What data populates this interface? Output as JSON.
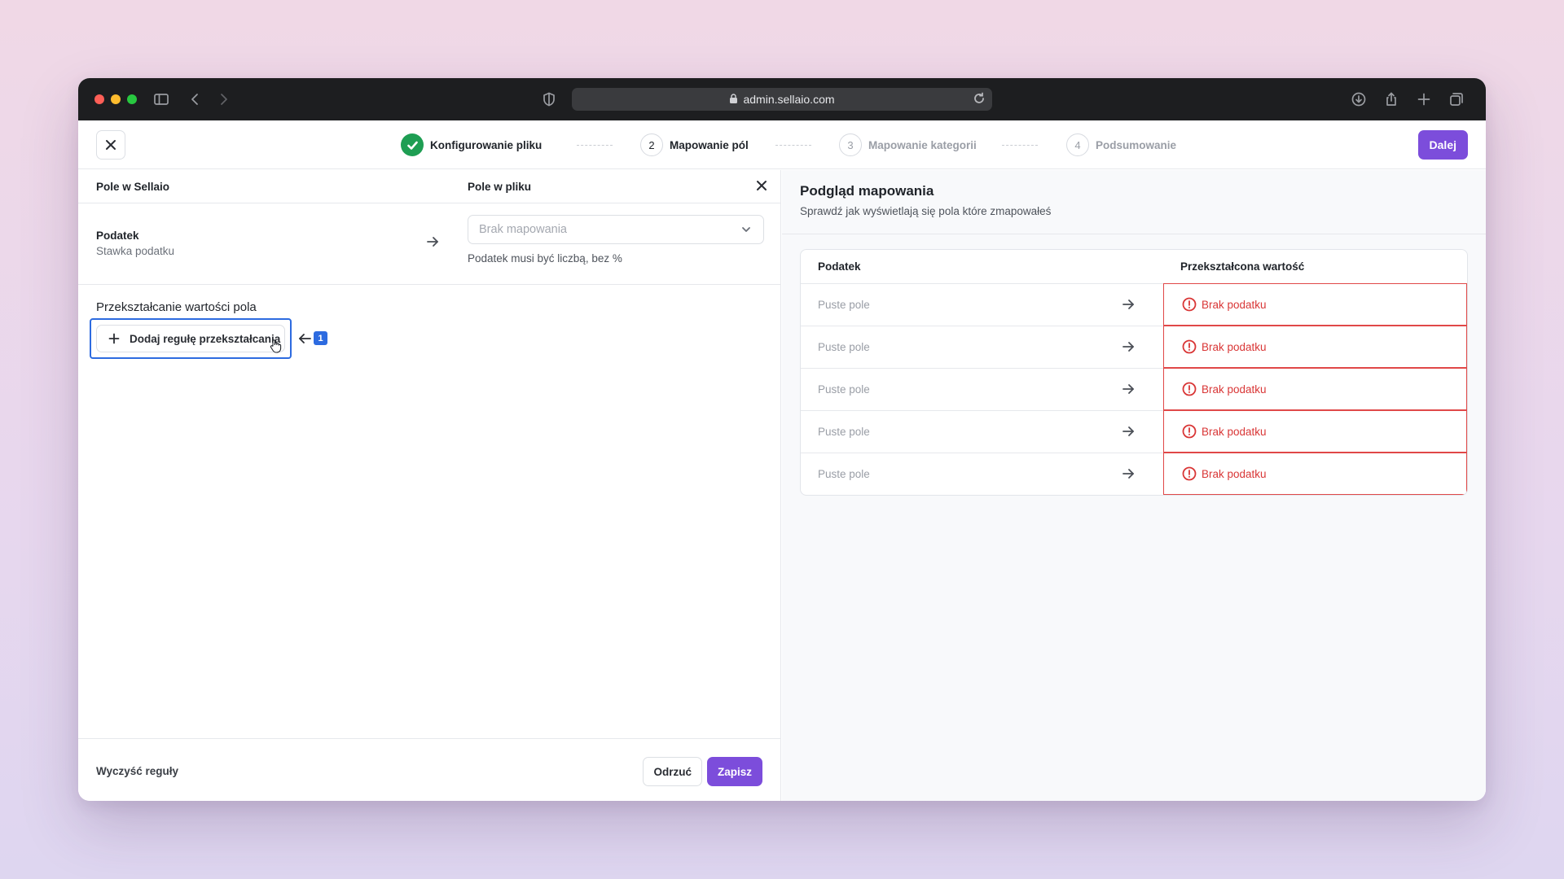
{
  "browser": {
    "url": "admin.sellaio.com"
  },
  "topbar": {
    "steps": [
      {
        "number": "",
        "label": "Konfigurowanie pliku",
        "state": "done"
      },
      {
        "number": "2",
        "label": "Mapowanie pól",
        "state": "active"
      },
      {
        "number": "3",
        "label": "Mapowanie kategorii",
        "state": "upcoming"
      },
      {
        "number": "4",
        "label": "Podsumowanie",
        "state": "upcoming"
      }
    ],
    "next_label": "Dalej"
  },
  "left": {
    "col_sellaio": "Pole w Sellaio",
    "col_file": "Pole w pliku",
    "field": {
      "name": "Podatek",
      "sub": "Stawka podatku",
      "select_placeholder": "Brak mapowania",
      "hint": "Podatek musi być liczbą, bez %"
    },
    "transform_title": "Przekształcanie wartości pola",
    "add_rule_label": "Dodaj regułę przekształcania",
    "callout_badge": "1",
    "clear_rules": "Wyczyść reguły",
    "discard": "Odrzuć",
    "save": "Zapisz"
  },
  "right": {
    "title": "Podgląd mapowania",
    "subtitle": "Sprawdź jak wyświetlają się pola które zmapowałeś",
    "table": {
      "headers": [
        "Podatek",
        "Przekształcona wartość"
      ],
      "rows": [
        {
          "source": "Puste pole",
          "result": "Brak podatku"
        },
        {
          "source": "Puste pole",
          "result": "Brak podatku"
        },
        {
          "source": "Puste pole",
          "result": "Brak podatku"
        },
        {
          "source": "Puste pole",
          "result": "Brak podatku"
        },
        {
          "source": "Puste pole",
          "result": "Brak podatku"
        }
      ]
    }
  },
  "colors": {
    "accent": "#7c4ddb",
    "success": "#1e9e53",
    "error": "#d93636",
    "focus": "#2d6be0"
  }
}
